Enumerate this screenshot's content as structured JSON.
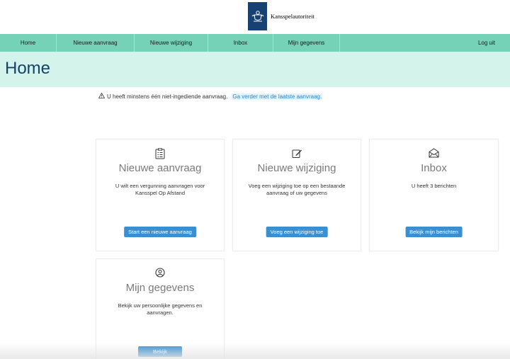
{
  "header": {
    "logo_text": "Kansspelautoriteit",
    "logo_icon": "royal-coat-of-arms",
    "brand_color": "#154273"
  },
  "nav": {
    "items": [
      {
        "label": "Home"
      },
      {
        "label": "Nieuwe aanvraag"
      },
      {
        "label": "Nieuwe wijziging"
      },
      {
        "label": "Inbox"
      },
      {
        "label": "Mijn gegevens"
      }
    ],
    "logout": "Log uit",
    "color": "#76d2b6"
  },
  "page": {
    "title": "Home",
    "banner_color": "#d4f3ea"
  },
  "notice": {
    "icon": "warning-icon",
    "text": "U heeft minstens één niet-ingediende aanvraag.",
    "link": "Ga verder met de laatste aanvraag."
  },
  "cards": [
    {
      "icon": "checklist-icon",
      "title": "Nieuwe aanvraag",
      "desc": "U wilt een vergunning aanvragen voor Kansspel Op Afstand",
      "button": "Start een nieuwe aanvraag"
    },
    {
      "icon": "edit-icon",
      "title": "Nieuwe wijziging",
      "desc": "Voeg een wijziging toe op een bestaande aanvraag of uw gegevens",
      "button": "Voeg een wijziging toe"
    },
    {
      "icon": "envelope-icon",
      "title": "Inbox",
      "desc": "U heeft 3 berichten",
      "button": "Bekijk mijn berichten"
    },
    {
      "icon": "user-icon",
      "title": "Mijn gegevens",
      "desc": "Bekijk uw persoonlijke gegevens en aanvragen.",
      "button": "Bekijk"
    }
  ],
  "button_color": "#3a8fd0"
}
